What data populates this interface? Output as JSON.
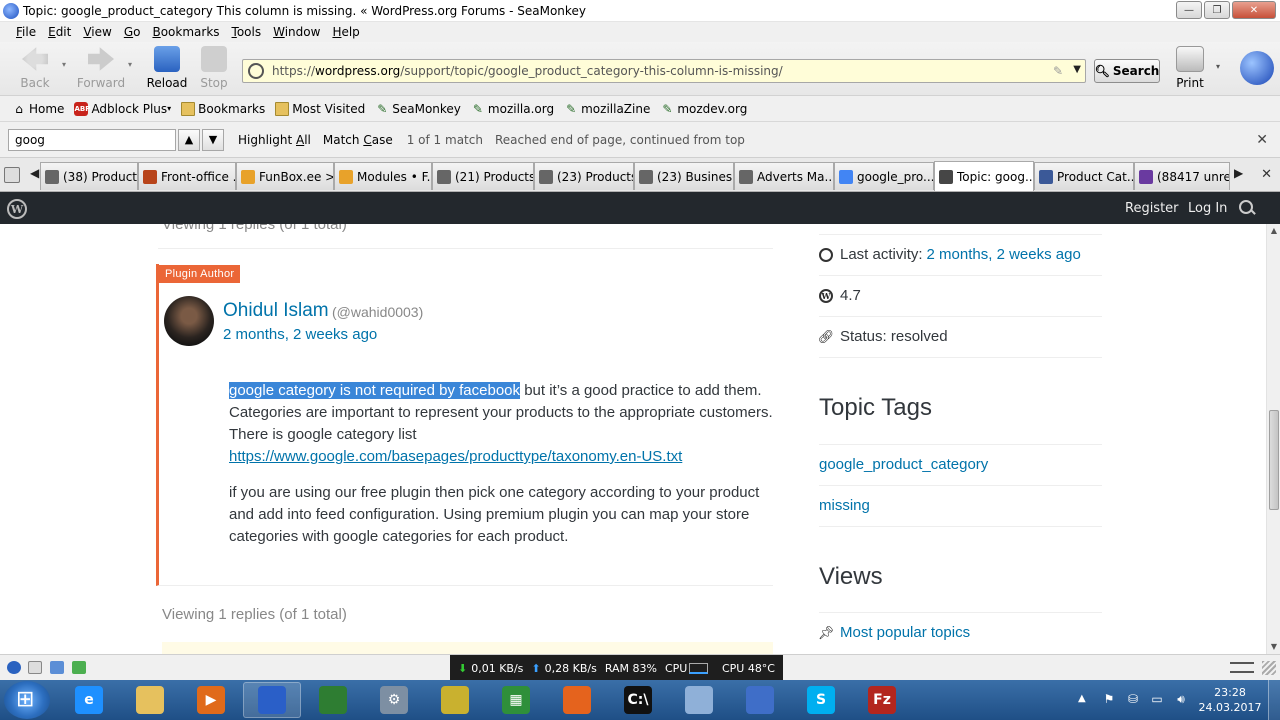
{
  "window": {
    "title": "Topic: google_product_category This column is missing. « WordPress.org Forums - SeaMonkey",
    "min_glyph": "—",
    "restore_glyph": "❐",
    "close_glyph": "✕"
  },
  "menu": [
    {
      "key": "F",
      "rest": "ile"
    },
    {
      "key": "E",
      "rest": "dit"
    },
    {
      "key": "V",
      "rest": "iew"
    },
    {
      "key": "G",
      "rest": "o"
    },
    {
      "key": "B",
      "rest": "ookmarks"
    },
    {
      "key": "T",
      "rest": "ools"
    },
    {
      "key": "W",
      "rest": "indow"
    },
    {
      "key": "H",
      "rest": "elp"
    }
  ],
  "nav": {
    "back_label": "Back",
    "forward_label": "Forward",
    "reload_label": "Reload",
    "stop_label": "Stop",
    "url_prefix": "https://",
    "url_domain": "wordpress.org",
    "url_path": "/support/topic/google_product_category-this-column-is-missing/",
    "search_label": "Search",
    "print_label": "Print"
  },
  "bookmarks": [
    {
      "label": "Home",
      "icon": "home-icon"
    },
    {
      "label": "Adblock Plus",
      "icon": "adblock-icon",
      "has_menu": true
    },
    {
      "label": "Bookmarks",
      "icon": "folder-icon"
    },
    {
      "label": "Most Visited",
      "icon": "folder-icon"
    },
    {
      "label": "SeaMonkey",
      "icon": "seamonkey-icon"
    },
    {
      "label": "mozilla.org",
      "icon": "seamonkey-icon"
    },
    {
      "label": "mozillaZine",
      "icon": "seamonkey-icon"
    },
    {
      "label": "mozdev.org",
      "icon": "seamonkey-icon"
    }
  ],
  "find": {
    "query": "goog",
    "highlight_all": "Highlight All",
    "highlight_all_key": "A",
    "match_case": "Match Case",
    "match_case_key": "C",
    "match_count": "1 of 1 match",
    "status": "Reached end of page, continued from top"
  },
  "tabs": [
    {
      "label": "(38) Products",
      "icon_color": "#666"
    },
    {
      "label": "Front-office ...",
      "icon_color": "#b8441a"
    },
    {
      "label": "FunBox.ee > ...",
      "icon_color": "#e8a22a"
    },
    {
      "label": "Modules • F...",
      "icon_color": "#e8a22a"
    },
    {
      "label": "(21) Products",
      "icon_color": "#666"
    },
    {
      "label": "(23) Products",
      "icon_color": "#666"
    },
    {
      "label": "(23) Busines...",
      "icon_color": "#666"
    },
    {
      "label": "Adverts Ma...",
      "icon_color": "#666"
    },
    {
      "label": "google_pro...",
      "icon_color": "#4285f4"
    },
    {
      "label": "Topic: goog...",
      "icon_color": "#464646",
      "active": true
    },
    {
      "label": "Product Cat...",
      "icon_color": "#3b5998"
    },
    {
      "label": "(88417 unre...",
      "icon_color": "#6a3aa0"
    }
  ],
  "wpbar": {
    "logo": "W",
    "register": "Register",
    "login": "Log In"
  },
  "reply": {
    "viewing_top": "Viewing 1 replies (of 1 total)",
    "badge": "Plugin Author",
    "author_name": "Ohidul Islam",
    "author_handle": "(@wahid0003)",
    "date": "2 months, 2 weeks ago",
    "p1_highlight": "google category is not required by facebook",
    "p1_rest": " but it’s a good practice to add them. Categories are important to represent your products to the appropriate customers. There is google category list ",
    "p1_link": "https://www.google.com/basepages/producttype/taxonomy.en-US.txt",
    "p2": "if you are using our free plugin then pick one category according to your product and add into feed configuration. Using premium plugin you can map your store categories with google categories for each product.",
    "viewing_bottom": "Viewing 1 replies (of 1 total)"
  },
  "sidebar": {
    "last_activity_label": "Last activity:",
    "last_activity_value": "2 months, 2 weeks ago",
    "version": "4.7",
    "status": "Status: resolved",
    "tags_heading": "Topic Tags",
    "tags": [
      "google_product_category",
      "missing"
    ],
    "views_heading": "Views",
    "views": [
      "Most popular topics"
    ]
  },
  "statusbar": {
    "down_rate": "0,01 KB/s",
    "up_rate": "0,28 KB/s",
    "ram": "RAM 83%",
    "cpu_label": "CPU",
    "cpu_temp": "CPU 48°C"
  },
  "taskbar": {
    "time": "23:28",
    "date": "24.03.2017",
    "apps": [
      {
        "name": "ie-icon",
        "color": "#1e90ff",
        "glyph": "e"
      },
      {
        "name": "explorer-icon",
        "color": "#e6c15e",
        "glyph": ""
      },
      {
        "name": "media-player-icon",
        "color": "#e06a1a",
        "glyph": "▶"
      },
      {
        "name": "seamonkey-icon",
        "color": "#2a5fc8",
        "glyph": "",
        "pinned": true
      },
      {
        "name": "system-monitor-icon",
        "color": "#2e7d32",
        "glyph": ""
      },
      {
        "name": "settings-gear-icon",
        "color": "#7d8fa3",
        "glyph": "⚙"
      },
      {
        "name": "notepad-icon",
        "color": "#c9b12f",
        "glyph": ""
      },
      {
        "name": "spreadsheet-icon",
        "color": "#2f8f3a",
        "glyph": "▦"
      },
      {
        "name": "firefox-icon",
        "color": "#e5631d",
        "glyph": ""
      },
      {
        "name": "terminal-icon",
        "color": "#111",
        "glyph": "C:\\"
      },
      {
        "name": "notes-icon",
        "color": "#8fb0d8",
        "glyph": ""
      },
      {
        "name": "thunderbird-icon",
        "color": "#3f6ec8",
        "glyph": ""
      },
      {
        "name": "skype-icon",
        "color": "#00aff0",
        "glyph": "S"
      },
      {
        "name": "filezilla-icon",
        "color": "#b3261e",
        "glyph": "Fz"
      }
    ]
  }
}
